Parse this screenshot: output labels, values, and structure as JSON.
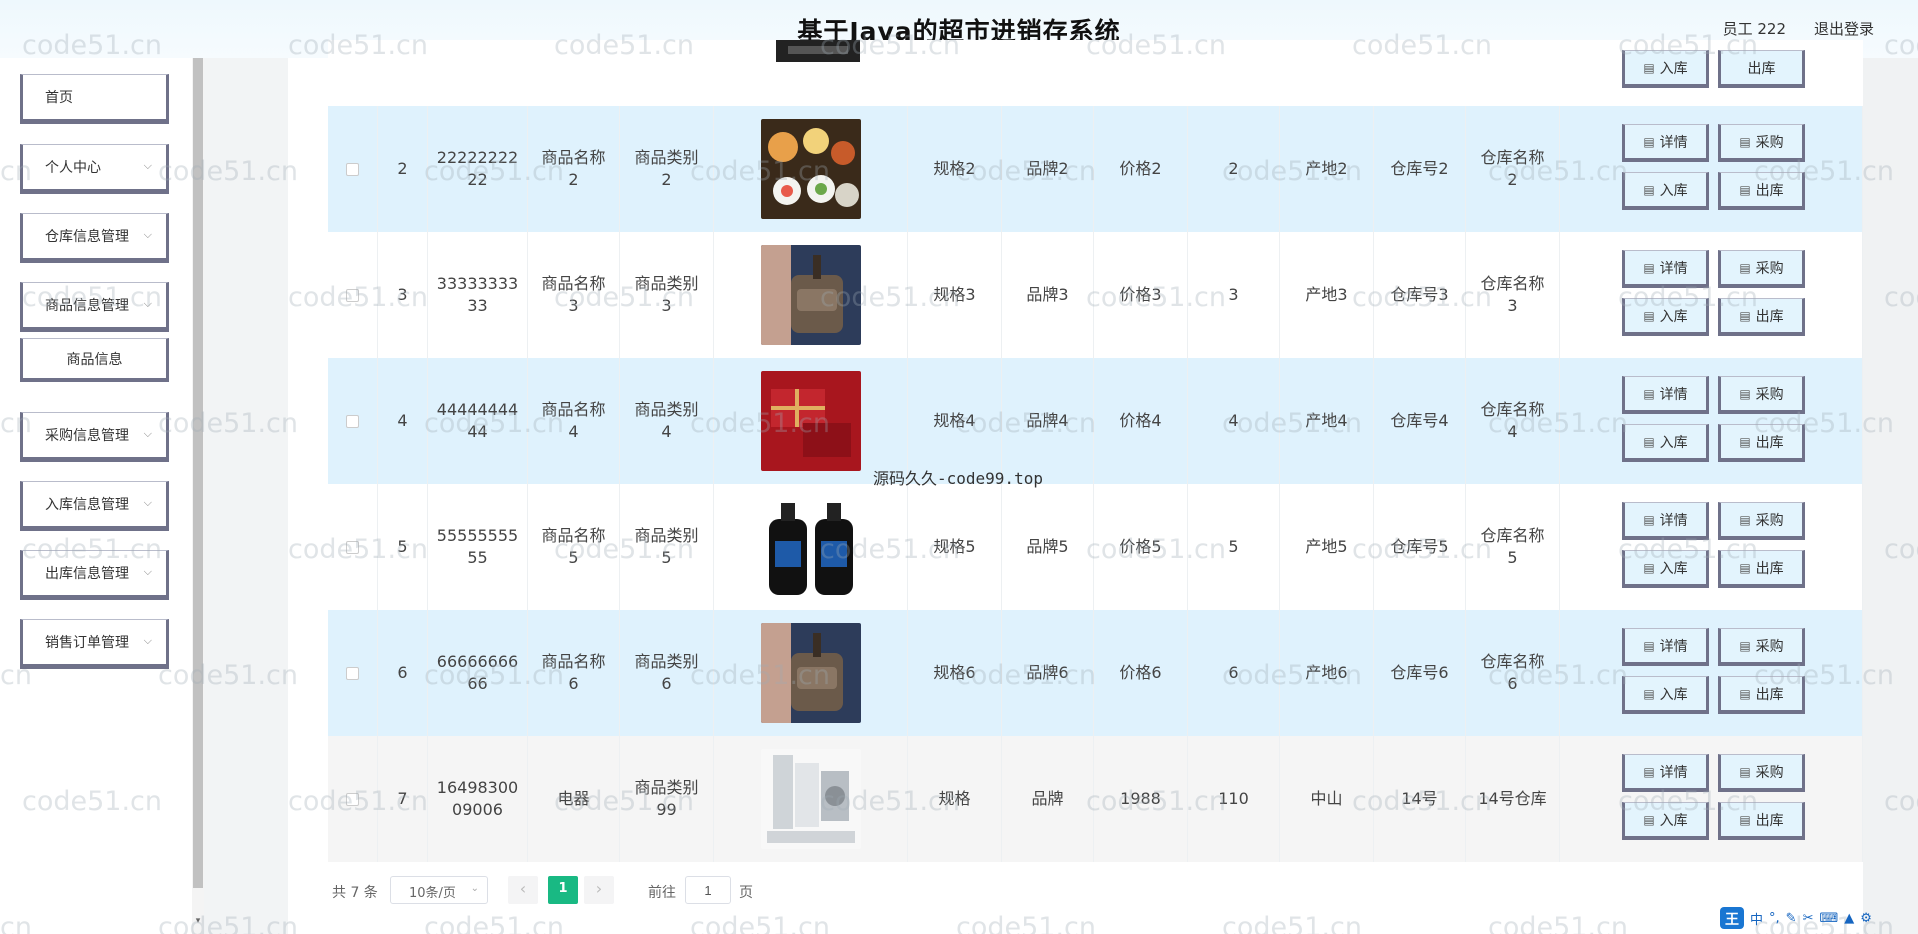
{
  "header": {
    "title": "基于Java的超市进销存系统",
    "user": "员工 222",
    "logout": "退出登录"
  },
  "sidebar": {
    "items": [
      {
        "label": "首页",
        "has_chevron": false
      },
      {
        "label": "个人中心",
        "has_chevron": true
      },
      {
        "label": "仓库信息管理",
        "has_chevron": true
      },
      {
        "label": "商品信息管理",
        "has_chevron": true
      },
      {
        "label": "商品信息",
        "submenu": true
      },
      {
        "label": "采购信息管理",
        "has_chevron": true
      },
      {
        "label": "入库信息管理",
        "has_chevron": true
      },
      {
        "label": "出库信息管理",
        "has_chevron": true
      },
      {
        "label": "销售订单管理",
        "has_chevron": true
      }
    ]
  },
  "table": {
    "rows": [
      {
        "index": "2",
        "code_line1": "22222222",
        "code_line2": "22",
        "name_line1": "商品名称",
        "name_line2": "2",
        "cat_line1": "商品类别",
        "cat_line2": "2",
        "image_desc": "sushi",
        "spec": "规格2",
        "brand": "品牌2",
        "price": "价格2",
        "qty": "2",
        "origin": "产地2",
        "wh_no": "仓库号2",
        "wh_name_line1": "仓库名称",
        "wh_name_line2": "2"
      },
      {
        "index": "3",
        "code_line1": "33333333",
        "code_line2": "33",
        "name_line1": "商品名称",
        "name_line2": "3",
        "cat_line1": "商品类别",
        "cat_line2": "3",
        "image_desc": "bag",
        "spec": "规格3",
        "brand": "品牌3",
        "price": "价格3",
        "qty": "3",
        "origin": "产地3",
        "wh_no": "仓库号3",
        "wh_name_line1": "仓库名称",
        "wh_name_line2": "3"
      },
      {
        "index": "4",
        "code_line1": "44444444",
        "code_line2": "44",
        "name_line1": "商品名称",
        "name_line2": "4",
        "cat_line1": "商品类别",
        "cat_line2": "4",
        "image_desc": "gift",
        "spec": "规格4",
        "brand": "品牌4",
        "price": "价格4",
        "qty": "4",
        "origin": "产地4",
        "wh_no": "仓库号4",
        "wh_name_line1": "仓库名称",
        "wh_name_line2": "4"
      },
      {
        "index": "5",
        "code_line1": "55555555",
        "code_line2": "55",
        "name_line1": "商品名称",
        "name_line2": "5",
        "cat_line1": "商品类别",
        "cat_line2": "5",
        "image_desc": "bottles",
        "spec": "规格5",
        "brand": "品牌5",
        "price": "价格5",
        "qty": "5",
        "origin": "产地5",
        "wh_no": "仓库号5",
        "wh_name_line1": "仓库名称",
        "wh_name_line2": "5"
      },
      {
        "index": "6",
        "code_line1": "66666666",
        "code_line2": "66",
        "name_line1": "商品名称",
        "name_line2": "6",
        "cat_line1": "商品类别",
        "cat_line2": "6",
        "image_desc": "bag",
        "spec": "规格6",
        "brand": "品牌6",
        "price": "价格6",
        "qty": "6",
        "origin": "产地6",
        "wh_no": "仓库号6",
        "wh_name_line1": "仓库名称",
        "wh_name_line2": "6"
      },
      {
        "index": "7",
        "code_line1": "16498300",
        "code_line2": "09006",
        "name_line1": "电器",
        "name_line2": "",
        "cat_line1": "商品类别",
        "cat_line2": "99",
        "image_desc": "appliances",
        "spec": "规格",
        "brand": "品牌",
        "price": "1988",
        "qty": "110",
        "origin": "中山",
        "wh_no": "14号",
        "wh_name_line1": "14号仓库",
        "wh_name_line2": ""
      }
    ],
    "buttons": {
      "detail": "详情",
      "purchase": "采购",
      "stock_in": "入库",
      "stock_out": "出库"
    }
  },
  "pagination": {
    "total": "共 7 条",
    "page_size": "10条/页",
    "current_page": "1",
    "goto_label": "前往",
    "goto_value": "1",
    "page_unit": "页"
  },
  "watermarks": {
    "site": "code51.cn",
    "source": "源码久久-code99.top"
  },
  "ime": {
    "logo": "王",
    "mode": "中"
  },
  "colors": {
    "row_highlight": "#dff2fd",
    "accent_green": "#19b983",
    "button_border": "#6f7189"
  }
}
